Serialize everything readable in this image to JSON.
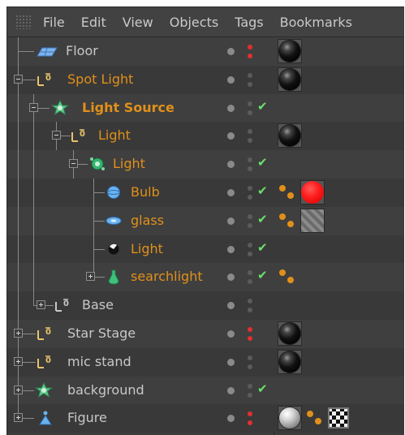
{
  "menubar": {
    "items": [
      "File",
      "Edit",
      "View",
      "Objects",
      "Tags",
      "Bookmarks"
    ]
  },
  "objects": [
    {
      "name": "Floor",
      "icon": "floor-icon",
      "color": "default"
    },
    {
      "name": "Spot Light",
      "icon": "null-icon",
      "color": "orange"
    },
    {
      "name": "Light Source",
      "icon": "light-source-icon",
      "color": "orange",
      "bold": true
    },
    {
      "name": "Light",
      "icon": "null-icon",
      "color": "orange"
    },
    {
      "name": "Light",
      "icon": "light-cluster-icon",
      "color": "orange"
    },
    {
      "name": "Bulb",
      "icon": "sphere-icon",
      "color": "orange"
    },
    {
      "name": "glass",
      "icon": "disc-icon",
      "color": "orange"
    },
    {
      "name": "Light",
      "icon": "omni-light-icon",
      "color": "orange"
    },
    {
      "name": "searchlight",
      "icon": "lathe-icon",
      "color": "orange"
    },
    {
      "name": "Base",
      "icon": "null-icon",
      "color": "default"
    },
    {
      "name": "Star Stage",
      "icon": "null-icon",
      "color": "default"
    },
    {
      "name": "mic stand",
      "icon": "null-icon",
      "color": "default"
    },
    {
      "name": "background",
      "icon": "light-source-icon",
      "color": "default"
    },
    {
      "name": "Figure",
      "icon": "figure-icon",
      "color": "default"
    }
  ],
  "colors": {
    "panel_bg": "#3c3c3c",
    "orange_text": "#e0901a",
    "check_green": "#6be06b",
    "visibility_red": "#e03030"
  }
}
